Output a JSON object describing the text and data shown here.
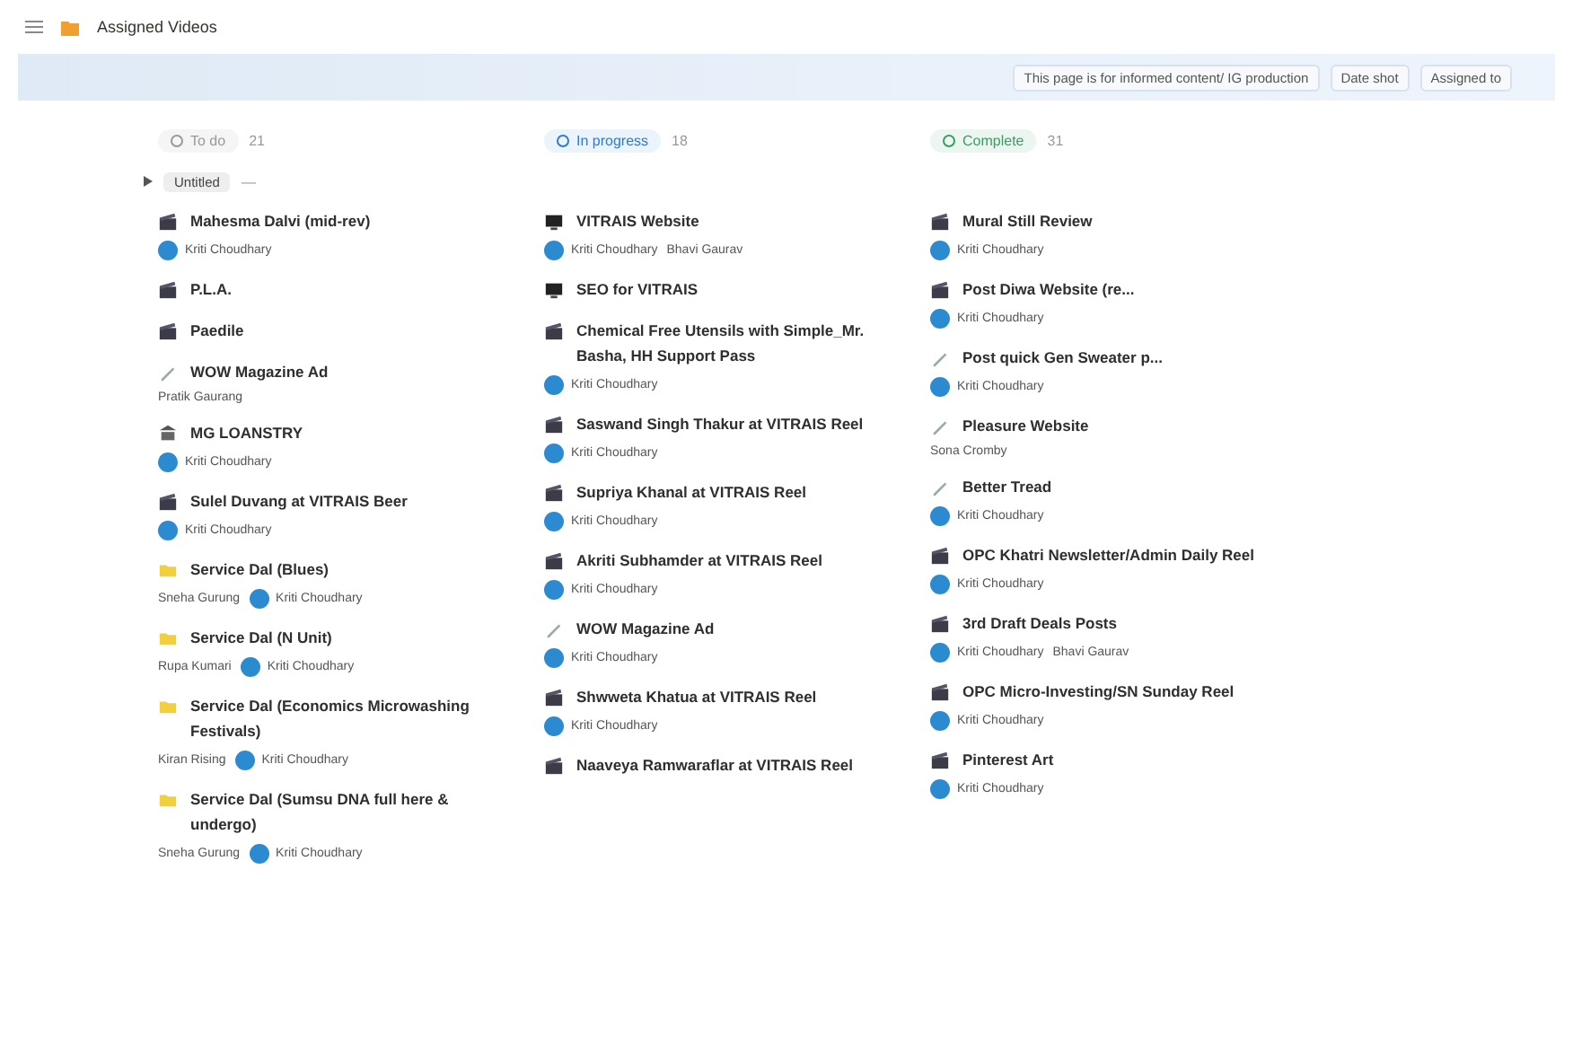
{
  "title": "Assigned Videos",
  "toolbar": [
    "This page is for informed content/ IG production",
    "Date shot",
    "Assigned to"
  ],
  "group": {
    "label": "Untitled",
    "count": "—"
  },
  "columns": [
    {
      "label": "To do",
      "count": "21",
      "color": "#9b9a97",
      "cards": [
        {
          "kind": "slate",
          "title": "Mahesma Dalvi (mid-rev)",
          "tags": [
            {
              "kind": "avatar",
              "name": "Kriti Choudhary"
            }
          ]
        },
        {
          "kind": "slate",
          "title": "P.L.A."
        },
        {
          "kind": "slate",
          "title": "Paedile"
        },
        {
          "kind": "pen",
          "title": "WOW Magazine Ad",
          "tags": [
            {
              "kind": "plain",
              "name": "Pratik Gaurang"
            }
          ]
        },
        {
          "kind": "bank",
          "title": "MG LOANSTRY",
          "tags": [
            {
              "kind": "avatar",
              "name": "Kriti Choudhary"
            }
          ]
        },
        {
          "kind": "slate",
          "title": "Sulel Duvang at VITRAIS Beer",
          "tags": [
            {
              "kind": "avatar",
              "name": "Kriti Choudhary"
            }
          ]
        },
        {
          "kind": "folder",
          "title": "Service Dal (Blues)",
          "tags": [
            {
              "kind": "plain",
              "name": "Sneha Gurung"
            },
            {
              "kind": "avatar",
              "name": "Kriti Choudhary"
            }
          ]
        },
        {
          "kind": "folder",
          "title": "Service Dal (N Unit)",
          "tags": [
            {
              "kind": "plain",
              "name": "Rupa Kumari"
            },
            {
              "kind": "avatar",
              "name": "Kriti Choudhary"
            }
          ]
        },
        {
          "kind": "folder",
          "title": "Service Dal (Economics Microwashing Festivals)",
          "tags": [
            {
              "kind": "plain",
              "name": "Kiran Rising"
            },
            {
              "kind": "avatar",
              "name": "Kriti Choudhary"
            }
          ]
        },
        {
          "kind": "folder",
          "title": "Service Dal (Sumsu DNA full here & undergo)",
          "tags": [
            {
              "kind": "plain",
              "name": "Sneha Gurung"
            },
            {
              "kind": "avatar",
              "name": "Kriti Choudhary"
            }
          ]
        }
      ]
    },
    {
      "label": "In progress",
      "count": "18",
      "color": "#2e7bd6",
      "cards": [
        {
          "kind": "monitor",
          "title": "VITRAIS Website",
          "tags": [
            {
              "kind": "avatar",
              "name": "Kriti Choudhary"
            },
            {
              "kind": "plain",
              "name": "Bhavi Gaurav"
            }
          ]
        },
        {
          "kind": "monitor",
          "title": "SEO for VITRAIS"
        },
        {
          "kind": "slate",
          "title": "Chemical Free Utensils with Simple_Mr. Basha, HH Support Pass",
          "tags": [
            {
              "kind": "avatar",
              "name": "Kriti Choudhary"
            }
          ]
        },
        {
          "kind": "slate",
          "title": "Saswand Singh Thakur at VITRAIS Reel",
          "tags": [
            {
              "kind": "avatar",
              "name": "Kriti Choudhary"
            }
          ]
        },
        {
          "kind": "slate",
          "title": "Supriya Khanal at VITRAIS Reel",
          "tags": [
            {
              "kind": "avatar",
              "name": "Kriti Choudhary"
            }
          ]
        },
        {
          "kind": "slate",
          "title": "Akriti Subhamder at VITRAIS Reel",
          "tags": [
            {
              "kind": "avatar",
              "name": "Kriti Choudhary"
            }
          ]
        },
        {
          "kind": "pen",
          "title": "WOW Magazine Ad",
          "tags": [
            {
              "kind": "avatar",
              "name": "Kriti Choudhary"
            }
          ]
        },
        {
          "kind": "slate",
          "title": "Shwweta Khatua at VITRAIS Reel",
          "tags": [
            {
              "kind": "avatar",
              "name": "Kriti Choudhary"
            }
          ]
        },
        {
          "kind": "slate",
          "title": "Naaveya Ramwaraflar at VITRAIS Reel"
        }
      ]
    },
    {
      "label": "Complete",
      "count": "31",
      "color": "#3a9e62",
      "cards": [
        {
          "kind": "slate",
          "title": "Mural Still Review",
          "tags": [
            {
              "kind": "avatar",
              "name": "Kriti Choudhary"
            }
          ]
        },
        {
          "kind": "slate",
          "title": "Post Diwa Website (re...",
          "tags": [
            {
              "kind": "avatar",
              "name": "Kriti Choudhary"
            }
          ]
        },
        {
          "kind": "pen",
          "title": "Post quick Gen Sweater p...",
          "tags": [
            {
              "kind": "avatar",
              "name": "Kriti Choudhary"
            }
          ]
        },
        {
          "kind": "pen",
          "title": "Pleasure Website",
          "tags": [
            {
              "kind": "plain",
              "name": "Sona Cromby"
            }
          ]
        },
        {
          "kind": "pen",
          "title": "Better Tread",
          "tags": [
            {
              "kind": "avatar",
              "name": "Kriti Choudhary"
            }
          ]
        },
        {
          "kind": "slate",
          "title": "OPC Khatri Newsletter/Admin Daily Reel",
          "tags": [
            {
              "kind": "avatar",
              "name": "Kriti Choudhary"
            }
          ]
        },
        {
          "kind": "slate",
          "title": "3rd Draft Deals Posts",
          "tags": [
            {
              "kind": "avatar",
              "name": "Kriti Choudhary"
            },
            {
              "kind": "plain",
              "name": "Bhavi Gaurav"
            }
          ]
        },
        {
          "kind": "slate",
          "title": "OPC Micro-Investing/SN Sunday Reel",
          "tags": [
            {
              "kind": "avatar",
              "name": "Kriti Choudhary"
            }
          ]
        },
        {
          "kind": "slate",
          "title": "Pinterest Art",
          "tags": [
            {
              "kind": "avatar",
              "name": "Kriti Choudhary"
            }
          ]
        }
      ]
    }
  ]
}
